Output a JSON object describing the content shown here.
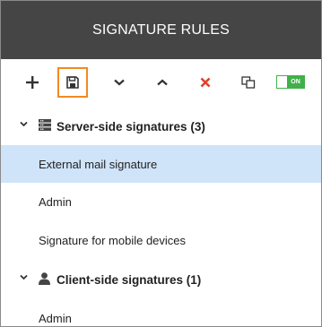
{
  "header": {
    "title": "SIGNATURE RULES"
  },
  "toolbar": {
    "buttons": [
      {
        "name": "add-button",
        "icon": "plus-icon"
      },
      {
        "name": "save-button",
        "icon": "save-icon",
        "active": true
      },
      {
        "name": "move-down-button",
        "icon": "chevron-down-icon"
      },
      {
        "name": "move-up-button",
        "icon": "chevron-up-icon"
      },
      {
        "name": "delete-button",
        "icon": "close-icon",
        "color": "#e0402a"
      },
      {
        "name": "copy-button",
        "icon": "copy-icon"
      }
    ],
    "toggle": {
      "label": "ON",
      "on": true,
      "color": "#40b14a"
    }
  },
  "groups": [
    {
      "label": "Server-side signatures (3)",
      "icon": "server-icon",
      "expanded": true,
      "items": [
        {
          "label": "External mail signature",
          "selected": true
        },
        {
          "label": "Admin",
          "selected": false
        },
        {
          "label": "Signature for mobile devices",
          "selected": false
        }
      ]
    },
    {
      "label": "Client-side signatures (1)",
      "icon": "user-icon",
      "expanded": true,
      "items": [
        {
          "label": "Admin",
          "selected": false
        }
      ]
    }
  ],
  "colors": {
    "header_bg": "#454545",
    "accent": "#f08a24",
    "selected_bg": "#cfe3f9"
  }
}
